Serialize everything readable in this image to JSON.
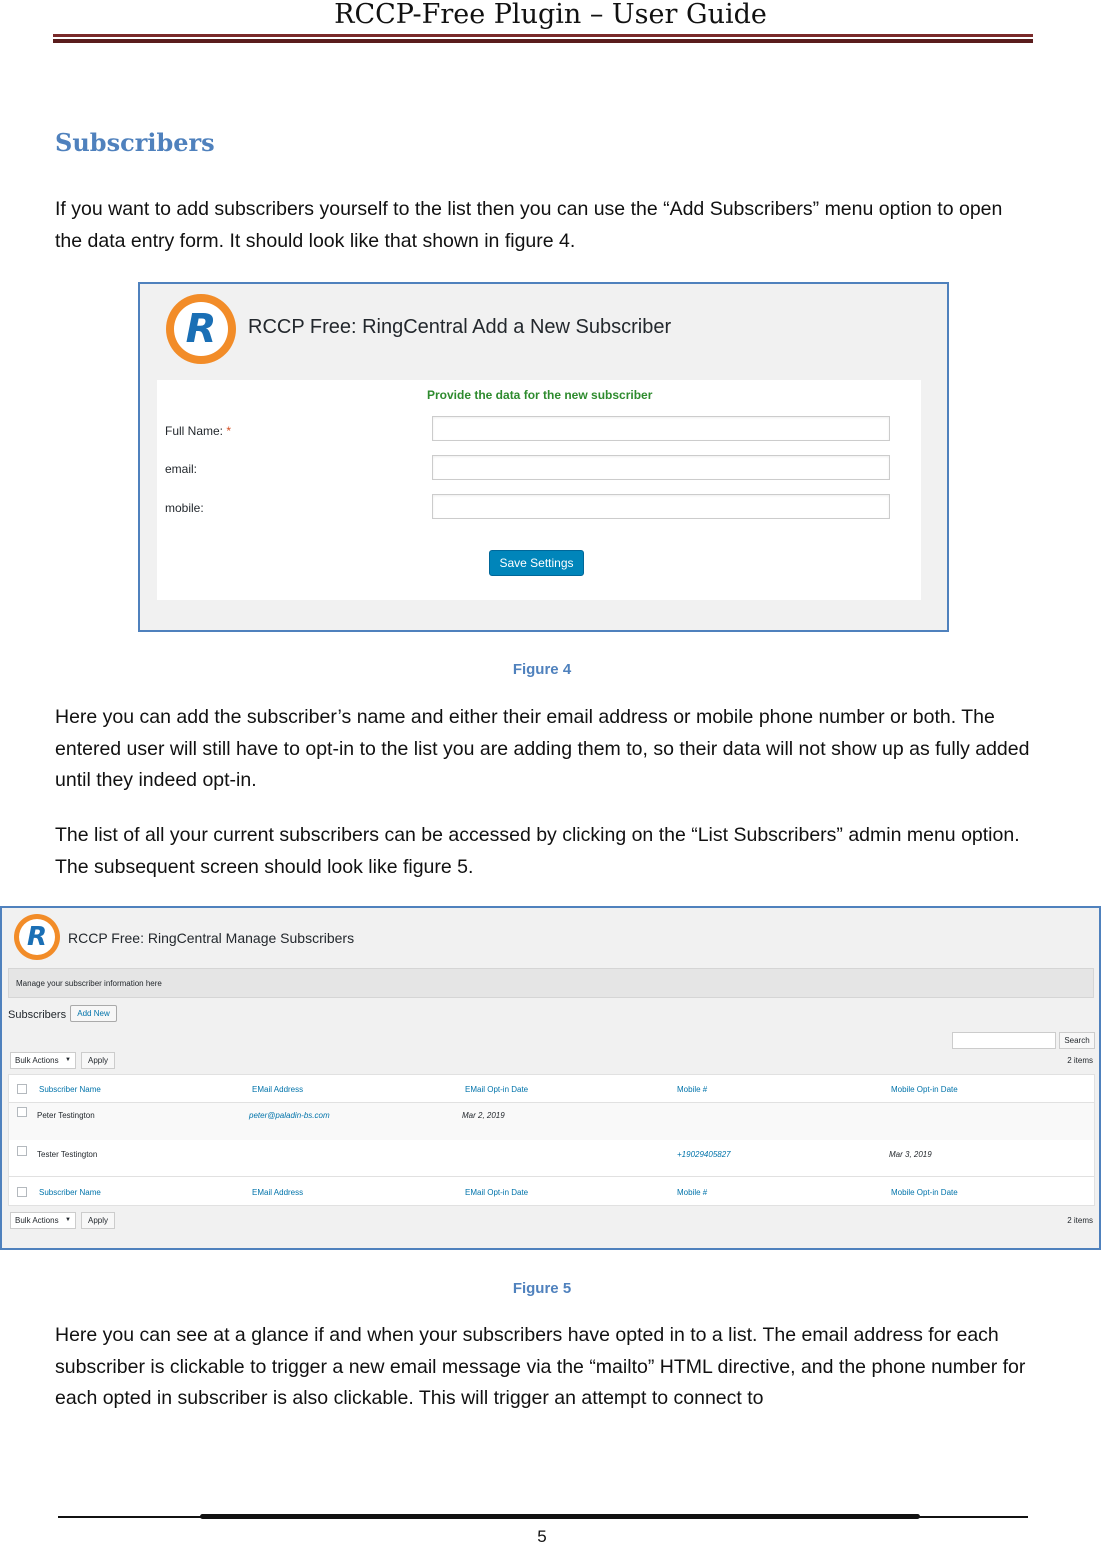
{
  "header": {
    "title": "RCCP-Free Plugin – User Guide"
  },
  "section": {
    "title": "Subscribers"
  },
  "paragraphs": {
    "p1": "If you want to add subscribers yourself to the list then you can use the “Add Subscribers” menu option to open the data entry form. It should look like that shown in figure 4.",
    "p2": "Here you can add the subscriber’s name and either their email address or mobile phone number or both. The entered user will still have to opt-in to the list you are adding them to, so their data will not show up as fully added until they indeed opt-in.",
    "p3": "The list of all your current subscribers can be accessed by clicking on the “List Subscribers” admin menu option. The subsequent screen should look like figure 5.",
    "p4": "Here you can see at a glance if and when your subscribers have opted in to a list. The email address for each subscriber is clickable to trigger a new email message via the “mailto” HTML directive, and the phone number for each opted in subscriber is also clickable. This will trigger an attempt to connect to"
  },
  "figure4": {
    "caption": "Figure 4",
    "logo_letter": "R",
    "title": "RCCP Free: RingCentral Add a New Subscriber",
    "form_heading": "Provide the data for the new subscriber",
    "fields": [
      {
        "label": "Full Name:",
        "required_mark": "*",
        "value": ""
      },
      {
        "label": "email:",
        "required_mark": "",
        "value": ""
      },
      {
        "label": "mobile:",
        "required_mark": "",
        "value": ""
      }
    ],
    "save_label": "Save Settings"
  },
  "figure5": {
    "caption": "Figure 5",
    "logo_letter": "R",
    "title": "RCCP Free: RingCentral Manage Subscribers",
    "notice": "Manage your subscriber information here",
    "subscribers_label": "Subscribers",
    "add_new_label": "Add New",
    "search_label": "Search",
    "search_value": "",
    "bulk_actions_label": "Bulk Actions",
    "apply_label": "Apply",
    "item_count": "2 items",
    "columns": [
      "Subscriber Name",
      "EMail Address",
      "EMail Opt-in Date",
      "Mobile #",
      "Mobile Opt-in Date"
    ],
    "rows": [
      {
        "name": "Peter Testington",
        "email": "peter@paladin-bs.com",
        "email_optin": "Mar 2, 2019",
        "mobile": "",
        "mobile_optin": ""
      },
      {
        "name": "Tester Testington",
        "email": "",
        "email_optin": "",
        "mobile": "+19029405827",
        "mobile_optin": "Mar 3, 2019"
      }
    ]
  },
  "footer": {
    "page_number": "5"
  },
  "colors": {
    "accent_blue": "#4f81bd",
    "header_rule": "#7a2a2a",
    "wp_button": "#0085ba",
    "logo_orange": "#f28c28"
  }
}
